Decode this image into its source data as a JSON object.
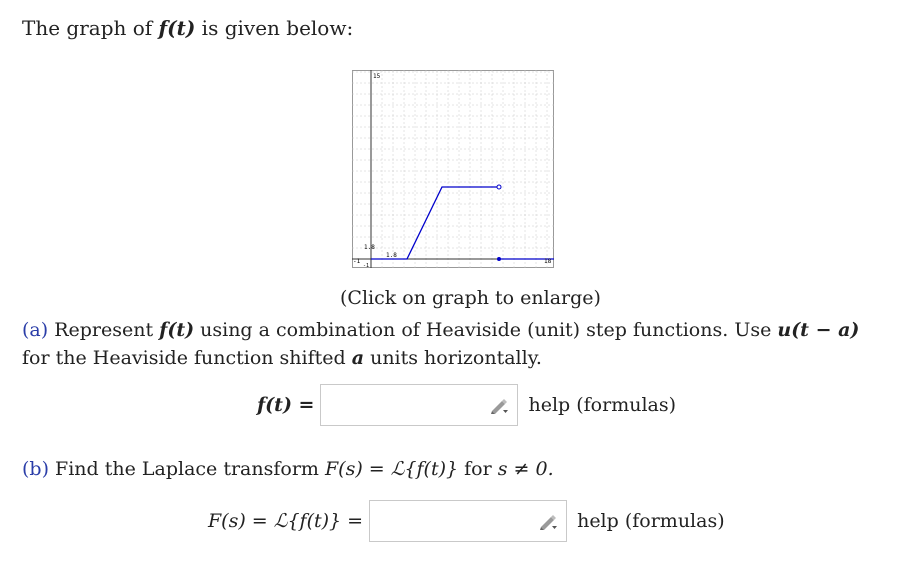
{
  "intro": {
    "prefix": "The graph of ",
    "func": "f(t)",
    "suffix": " is given below:"
  },
  "graph": {
    "caption": "(Click on graph to enlarge)",
    "tick_labels": {
      "y_top": "15",
      "y_mid": "1.8",
      "x_mid": "1.8",
      "x_left": "-1",
      "y_bottom": "-1",
      "x_right": "18"
    },
    "colors": {
      "curve": "#0000cc",
      "axis": "#333333",
      "grid": "#c8c8c8"
    }
  },
  "part_a": {
    "label": "(a)",
    "text1": " Represent ",
    "func": "f(t)",
    "text2": " using a combination of Heaviside (unit) step functions. Use ",
    "step": "u(t − a)",
    "text3": " for the Heaviside function shifted ",
    "a": "a",
    "text4": " units horizontally.",
    "lhs": "f(t) =",
    "input_value": "",
    "help": "help (formulas)"
  },
  "part_b": {
    "label": "(b)",
    "text1": " Find the Laplace transform ",
    "expr": "F(s) = ℒ{f(t)}",
    "text2": " for ",
    "cond": "s ≠ 0.",
    "lhs": "F(s) = ℒ{f(t)} =",
    "input_value": "",
    "help": "help (formulas)"
  },
  "icons": {
    "pencil": "pencil-icon"
  }
}
